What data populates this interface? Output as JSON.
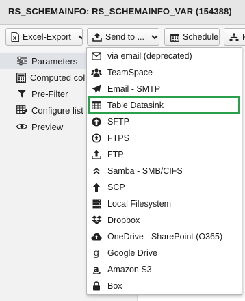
{
  "window": {
    "title": "RS_SCHEMAINFO: RS_SCHEMAINFO_VAR (154388)"
  },
  "toolbar": {
    "excel_export": {
      "label": "Excel-Export",
      "icon": "excel-file-icon"
    },
    "send_to": {
      "label": "Send to ...",
      "icon": "share-upload-icon"
    },
    "schedule": {
      "label": "Schedule",
      "icon": "calendar-icon"
    },
    "overflow": {
      "label": "P",
      "icon": "sitemap-icon"
    }
  },
  "sidebar": {
    "items": [
      {
        "label": "Parameters",
        "icon": "sliders-icon",
        "active": true
      },
      {
        "label": "Computed columns",
        "icon": "calculator-icon",
        "active": false
      },
      {
        "label": "Pre-Filter",
        "icon": "filter-icon",
        "active": false
      },
      {
        "label": "Configure list",
        "icon": "table-edit-icon",
        "active": false
      },
      {
        "label": "Preview",
        "icon": "eye-icon",
        "active": false
      }
    ]
  },
  "send_menu": {
    "items": [
      {
        "label": "via email (deprecated)",
        "icon": "envelope-outline-icon"
      },
      {
        "label": "TeamSpace",
        "icon": "users-icon"
      },
      {
        "label": "Email - SMTP",
        "icon": "paper-plane-icon"
      },
      {
        "label": "Table Datasink",
        "icon": "table-icon",
        "highlighted": true
      },
      {
        "label": "SFTP",
        "icon": "arrow-circle-up-icon"
      },
      {
        "label": "FTPS",
        "icon": "arrow-circle-up-outline-icon"
      },
      {
        "label": "FTP",
        "icon": "upload-icon"
      },
      {
        "label": "Samba - SMB/CIFS",
        "icon": "double-chevron-up-icon"
      },
      {
        "label": "SCP",
        "icon": "arrow-up-icon"
      },
      {
        "label": "Local Filesystem",
        "icon": "server-icon"
      },
      {
        "label": "Dropbox",
        "icon": "dropbox-icon"
      },
      {
        "label": "OneDrive - SharePoint (O365)",
        "icon": "cloud-upload-icon"
      },
      {
        "label": "Google Drive",
        "icon": "google-icon"
      },
      {
        "label": "Amazon S3",
        "icon": "amazon-icon"
      },
      {
        "label": "Box",
        "icon": "lock-icon"
      }
    ]
  },
  "colors": {
    "highlight_border": "#2aa04a",
    "titlebar_bg": "#e6e6e6"
  }
}
